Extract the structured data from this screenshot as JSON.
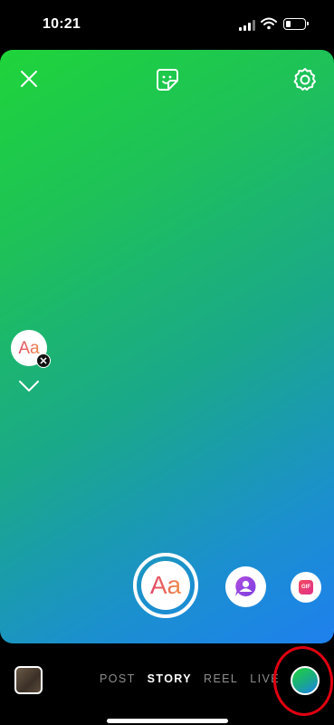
{
  "status_bar": {
    "time": "10:21",
    "signal_icon": "cellular-signal-icon",
    "wifi_icon": "wifi-icon",
    "battery_icon": "battery-icon",
    "battery_level": 0.25
  },
  "canvas": {
    "background_colors": [
      "#1fd43a",
      "#1aa88a",
      "#1e80ee"
    ],
    "close_icon": "close-icon",
    "sticker_icon": "sticker-icon",
    "settings_icon": "gear-icon",
    "text_tool": {
      "label": "Aa",
      "badge_icon": "remove-icon"
    },
    "collapse_icon": "chevron-down-icon",
    "capture": {
      "label": "Aa"
    },
    "mention_icon": "mention-icon",
    "gif": {
      "label": "GIF"
    }
  },
  "bottom_bar": {
    "modes": [
      {
        "label": "POST",
        "active": false
      },
      {
        "label": "STORY",
        "active": true
      },
      {
        "label": "REEL",
        "active": false
      },
      {
        "label": "LIVE",
        "active": false
      }
    ],
    "color_picker_icon": "color-picker-icon",
    "highlight_color": "#e00010"
  }
}
